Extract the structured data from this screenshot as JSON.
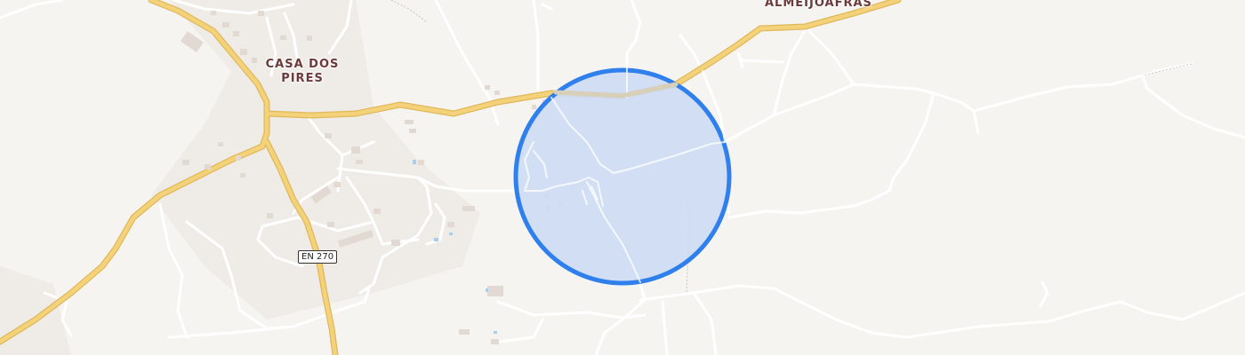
{
  "map": {
    "places": [
      {
        "name": "ALMEIJOAFRAS"
      },
      {
        "name": "CASA DOS\nPIRES"
      }
    ],
    "road_shield": "EN 270",
    "colors": {
      "background": "#f6f4f1",
      "minor_road": "#ffffff",
      "major_road": "#f3d27a",
      "accuracy_fill": "#cddcf3",
      "accuracy_stroke": "#2f80ed",
      "building": "#e6dfd9",
      "water": "#a9cdea"
    },
    "marker": "location-accuracy-circle"
  }
}
